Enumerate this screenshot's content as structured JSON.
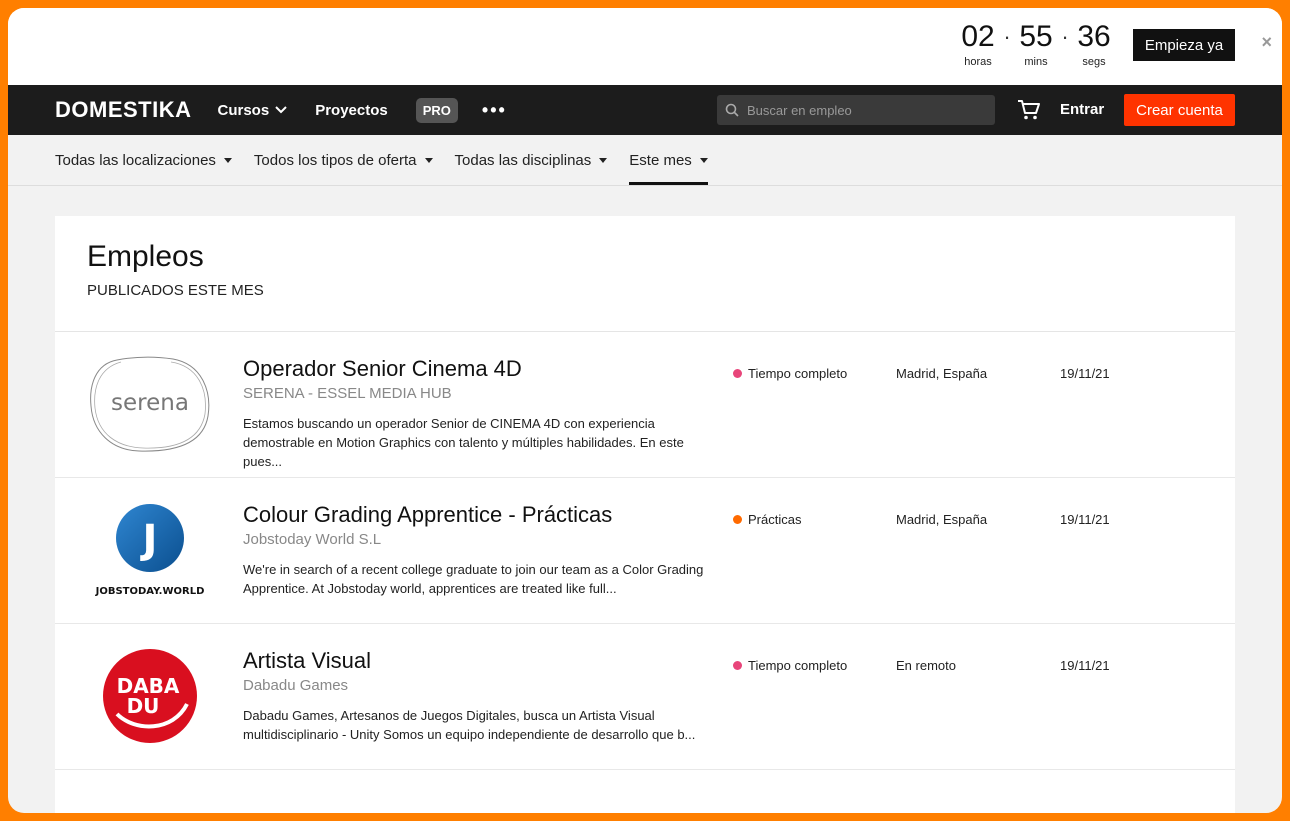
{
  "promo": {
    "hours": "02",
    "hours_label": "horas",
    "mins": "55",
    "mins_label": "mins",
    "secs": "36",
    "secs_label": "segs",
    "sep": "·",
    "cta": "Empieza ya",
    "close": "×"
  },
  "nav": {
    "logo": "DOMESTIKA",
    "courses": "Cursos",
    "projects": "Proyectos",
    "pro": "PRO",
    "more": "•••",
    "search_placeholder": "Buscar en empleo",
    "login": "Entrar",
    "signup": "Crear cuenta"
  },
  "filters": [
    {
      "label": "Todas las localizaciones"
    },
    {
      "label": "Todos los tipos de oferta"
    },
    {
      "label": "Todas las disciplinas"
    },
    {
      "label": "Este mes"
    }
  ],
  "page": {
    "title": "Empleos",
    "subtitle": "PUBLICADOS ESTE MES"
  },
  "jobs": [
    {
      "title": "Operador Senior Cinema 4D",
      "company": "SERENA - ESSEL MEDIA HUB",
      "description": "Estamos buscando un operador Senior de CINEMA 4D con experiencia demostrable en Motion Graphics con talento y múltiples habilidades. En este pues...",
      "type": "Tiempo completo",
      "type_color": "#e8457a",
      "location": "Madrid, España",
      "date": "19/11/21",
      "logo_text": "serena"
    },
    {
      "title": "Colour Grading Apprentice - Prácticas",
      "company": "Jobstoday World S.L",
      "description": "We're in search of a recent college graduate to join our team as a Color Grading Apprentice. At Jobstoday world, apprentices are treated like full...",
      "type": "Prácticas",
      "type_color": "#ff6a00",
      "location": "Madrid, España",
      "date": "19/11/21",
      "logo_text": "J",
      "logo_caption": "JOBSTODAY.WORLD"
    },
    {
      "title": "Artista Visual",
      "company": "Dabadu Games",
      "description": "Dabadu Games, Artesanos de Juegos Digitales, busca un Artista Visual multidisciplinario - Unity Somos un equipo independiente de desarrollo que b...",
      "type": "Tiempo completo",
      "type_color": "#e8457a",
      "location": "En remoto",
      "date": "19/11/21",
      "logo_line1": "DABA",
      "logo_line2": "DU"
    }
  ],
  "colors": {
    "accent": "#ff3300",
    "frame": "#ff7f00",
    "nav_bg": "#1c1c1c"
  }
}
